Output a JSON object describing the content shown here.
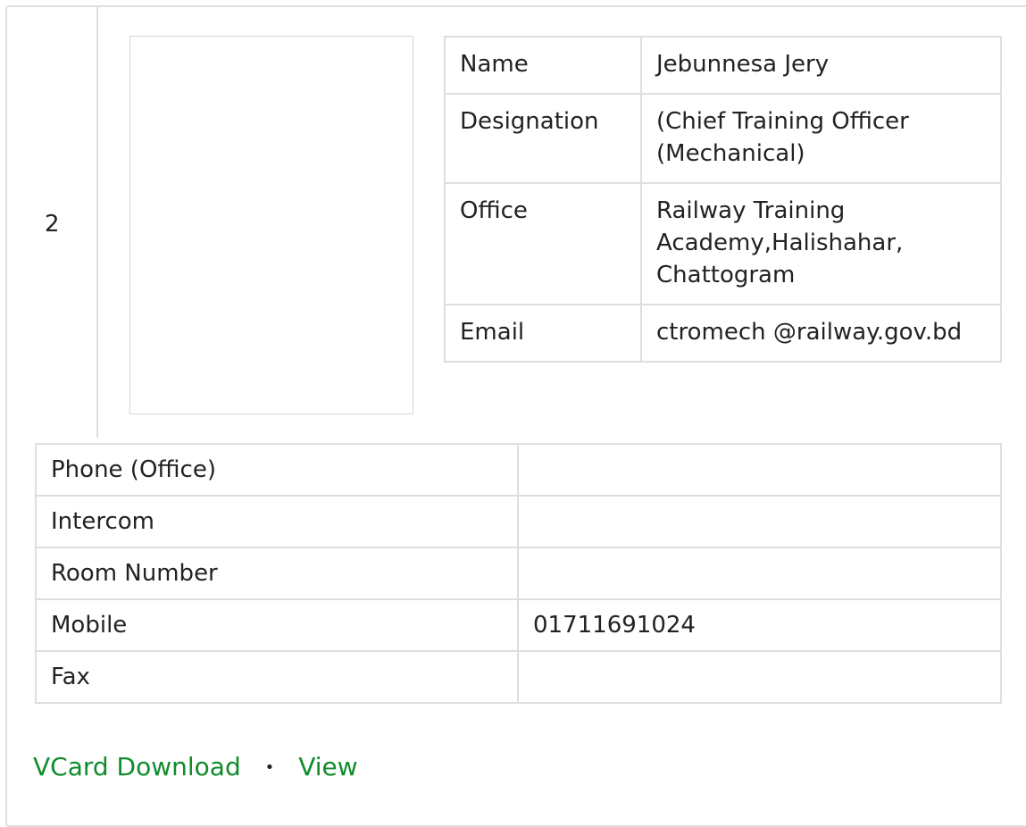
{
  "serial": "2",
  "profile": {
    "rows": [
      {
        "key": "Name",
        "value": "Jebunnesa Jery"
      },
      {
        "key": "Designation",
        "value": "(Chief Training Officer (Mechanical)"
      },
      {
        "key": "Office",
        "value": "Railway Training Academy,Halishahar, Chattogram"
      },
      {
        "key": "Email",
        "value": "ctromech @railway.gov.bd"
      }
    ]
  },
  "contact": {
    "rows": [
      {
        "key": "Phone (Office)",
        "value": ""
      },
      {
        "key": "Intercom",
        "value": ""
      },
      {
        "key": "Room Number",
        "value": ""
      },
      {
        "key": "Mobile",
        "value": "01711691024"
      },
      {
        "key": "Fax",
        "value": ""
      }
    ]
  },
  "links": {
    "vcard_label": "VCard Download",
    "separator": "•",
    "view_label": "View"
  },
  "colors": {
    "link": "#108c2c",
    "border": "#dedede"
  }
}
